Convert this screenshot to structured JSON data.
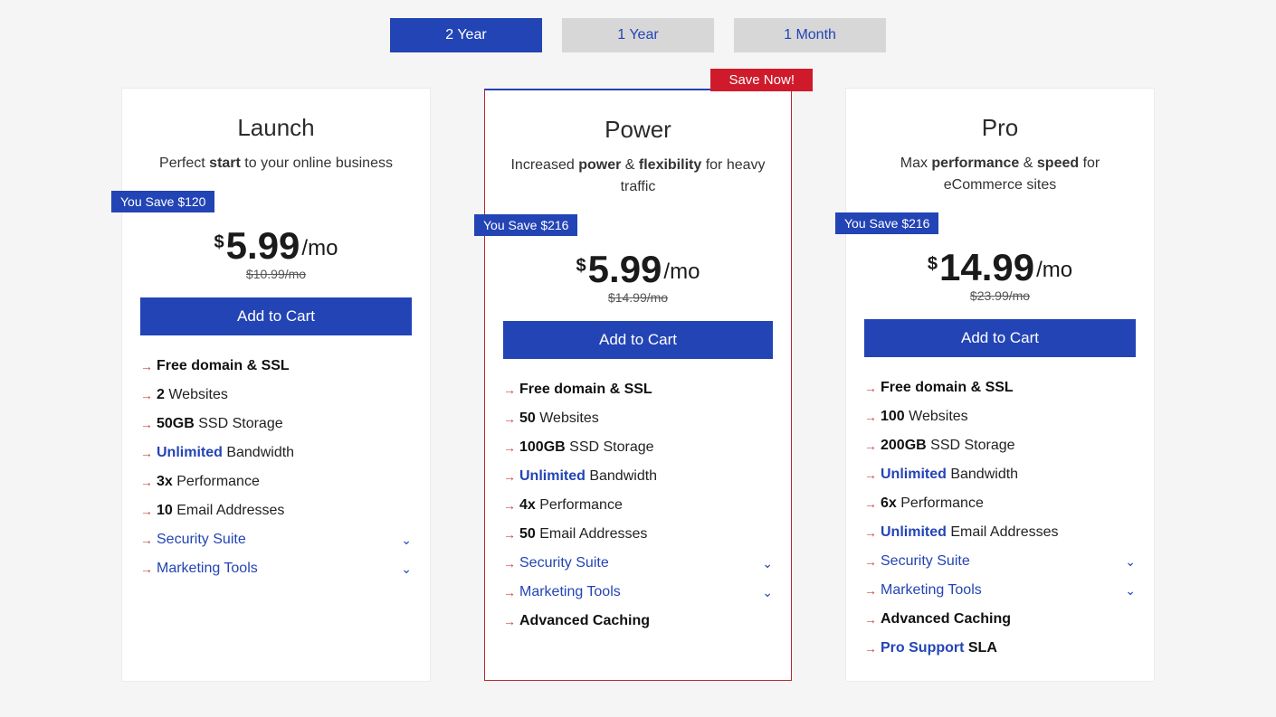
{
  "tabs": [
    {
      "label": "2 Year",
      "active": true
    },
    {
      "label": "1 Year",
      "active": false
    },
    {
      "label": "1 Month",
      "active": false
    }
  ],
  "save_now_label": "Save Now!",
  "cart_label": "Add to Cart",
  "plans": [
    {
      "name": "Launch",
      "subtitle_pre": "Perfect ",
      "subtitle_bold1": "start",
      "subtitle_mid": " to your online business",
      "subtitle_bold2": "",
      "subtitle_post": "",
      "save_badge": "You Save $120",
      "currency": "$",
      "price": "5.99",
      "per": "/mo",
      "old_price": "$10.99/mo",
      "highlight": false,
      "save_now": false,
      "features": [
        {
          "type": "strong-all",
          "text": "Free domain & SSL"
        },
        {
          "type": "bold-lead",
          "lead": "2",
          "rest": " Websites"
        },
        {
          "type": "bold-lead",
          "lead": "50GB",
          "rest": " SSD Storage"
        },
        {
          "type": "hl-lead",
          "lead": "Unlimited",
          "rest": " Bandwidth"
        },
        {
          "type": "bold-lead",
          "lead": "3x",
          "rest": " Performance"
        },
        {
          "type": "bold-lead",
          "lead": "10",
          "rest": " Email Addresses"
        },
        {
          "type": "expand",
          "text": "Security Suite"
        },
        {
          "type": "expand",
          "text": "Marketing Tools"
        }
      ]
    },
    {
      "name": "Power",
      "subtitle_pre": "Increased ",
      "subtitle_bold1": "power",
      "subtitle_mid": " & ",
      "subtitle_bold2": "flexibility",
      "subtitle_post": " for heavy traffic",
      "save_badge": "You Save $216",
      "currency": "$",
      "price": "5.99",
      "per": "/mo",
      "old_price": "$14.99/mo",
      "highlight": true,
      "save_now": true,
      "features": [
        {
          "type": "strong-all",
          "text": "Free domain & SSL"
        },
        {
          "type": "bold-lead",
          "lead": "50",
          "rest": " Websites"
        },
        {
          "type": "bold-lead",
          "lead": "100GB",
          "rest": " SSD Storage"
        },
        {
          "type": "hl-lead",
          "lead": "Unlimited",
          "rest": " Bandwidth"
        },
        {
          "type": "bold-lead",
          "lead": "4x",
          "rest": " Performance"
        },
        {
          "type": "bold-lead",
          "lead": "50",
          "rest": " Email Addresses"
        },
        {
          "type": "expand",
          "text": "Security Suite"
        },
        {
          "type": "expand",
          "text": "Marketing Tools"
        },
        {
          "type": "strong-all",
          "text": "Advanced Caching"
        }
      ]
    },
    {
      "name": "Pro",
      "subtitle_pre": "Max ",
      "subtitle_bold1": "performance",
      "subtitle_mid": " & ",
      "subtitle_bold2": "speed",
      "subtitle_post": " for eCommerce sites",
      "save_badge": "You Save $216",
      "currency": "$",
      "price": "14.99",
      "per": "/mo",
      "old_price": "$23.99/mo",
      "highlight": false,
      "save_now": false,
      "features": [
        {
          "type": "strong-all",
          "text": "Free domain & SSL"
        },
        {
          "type": "bold-lead",
          "lead": "100",
          "rest": " Websites"
        },
        {
          "type": "bold-lead",
          "lead": "200GB",
          "rest": " SSD Storage"
        },
        {
          "type": "hl-lead",
          "lead": "Unlimited",
          "rest": " Bandwidth"
        },
        {
          "type": "bold-lead",
          "lead": "6x",
          "rest": " Performance"
        },
        {
          "type": "hl-lead",
          "lead": "Unlimited",
          "rest": " Email Addresses"
        },
        {
          "type": "expand",
          "text": "Security Suite"
        },
        {
          "type": "expand",
          "text": "Marketing Tools"
        },
        {
          "type": "strong-all",
          "text": "Advanced Caching"
        },
        {
          "type": "hl-bold-rest",
          "lead": "Pro Support",
          "rest": " SLA"
        }
      ]
    }
  ]
}
